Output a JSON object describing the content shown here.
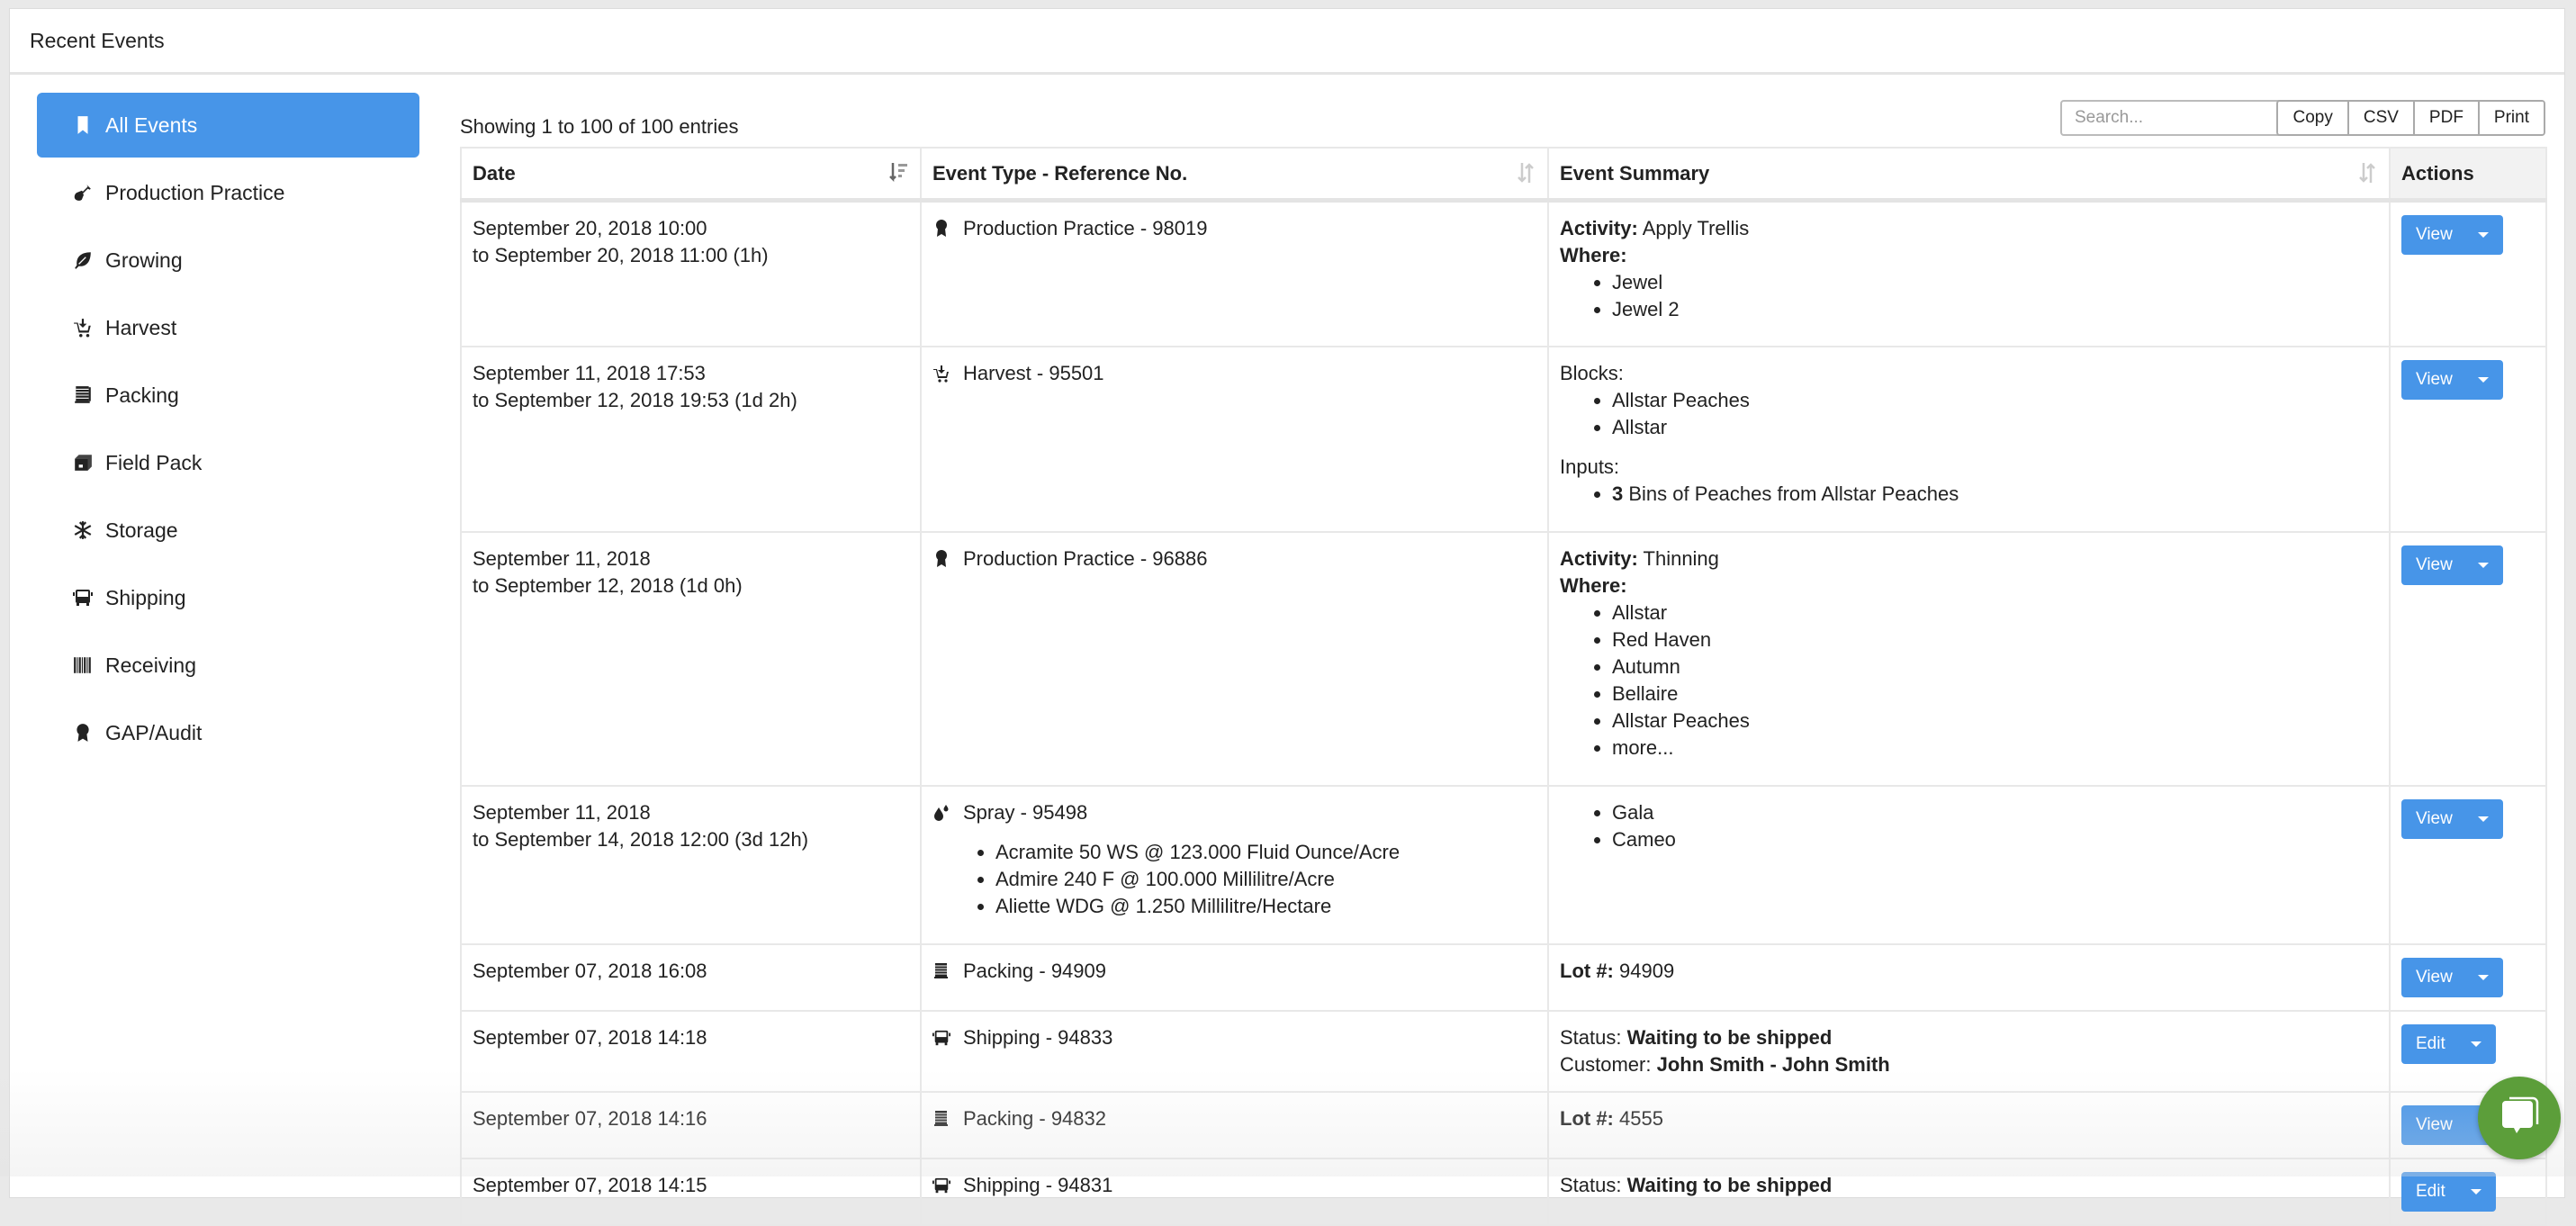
{
  "panel": {
    "title": "Recent Events"
  },
  "sidebar": {
    "items": [
      {
        "label": "All Events",
        "icon": "bookmark-icon",
        "active": true
      },
      {
        "label": "Production Practice",
        "icon": "shovel-icon"
      },
      {
        "label": "Growing",
        "icon": "leaf-icon"
      },
      {
        "label": "Harvest",
        "icon": "cart-download-icon"
      },
      {
        "label": "Packing",
        "icon": "pallet-boxes-icon"
      },
      {
        "label": "Field Pack",
        "icon": "box-icon"
      },
      {
        "label": "Storage",
        "icon": "snowflake-icon"
      },
      {
        "label": "Shipping",
        "icon": "truck-icon"
      },
      {
        "label": "Receiving",
        "icon": "barcode-icon"
      },
      {
        "label": "GAP/Audit",
        "icon": "award-icon"
      }
    ]
  },
  "toolbar": {
    "showing": "Showing 1 to 100 of 100 entries",
    "search_placeholder": "Search...",
    "search_value": "",
    "buttons": {
      "copy": "Copy",
      "csv": "CSV",
      "pdf": "PDF",
      "print": "Print"
    }
  },
  "table": {
    "headers": {
      "date": "Date",
      "event_type": "Event Type - Reference No.",
      "summary": "Event Summary",
      "actions": "Actions"
    },
    "rows": [
      {
        "date1": "September 20, 2018 10:00",
        "date2": "to September 20, 2018 11:00 (1h)",
        "type": "Production Practice - 98019",
        "icon": "award-icon",
        "activity_label": "Activity:",
        "activity": "Apply Trellis",
        "where_label": "Where:",
        "where": [
          "Jewel",
          "Jewel 2"
        ],
        "action": "View"
      },
      {
        "date1": "September 11, 2018 17:53",
        "date2": "to September 12, 2018 19:53 (1d 2h)",
        "type": "Harvest - 95501",
        "icon": "cart-download-icon",
        "blocks_label": "Blocks:",
        "blocks": [
          "Allstar Peaches",
          "Allstar"
        ],
        "inputs_label": "Inputs:",
        "inputs_qty": "3",
        "inputs_text": "Bins of Peaches from Allstar Peaches",
        "action": "View"
      },
      {
        "date1": "September 11, 2018",
        "date2": "to September 12, 2018 (1d 0h)",
        "type": "Production Practice - 96886",
        "icon": "award-icon",
        "activity_label": "Activity:",
        "activity": "Thinning",
        "where_label": "Where:",
        "where": [
          "Allstar",
          "Red Haven",
          "Autumn",
          "Bellaire",
          "Allstar Peaches",
          "more..."
        ],
        "action": "View"
      },
      {
        "date1": "September 11, 2018",
        "date2": "to September 14, 2018 12:00 (3d 12h)",
        "type": "Spray - 95498",
        "icon": "droplets-icon",
        "products": [
          "Acramite 50 WS @ 123.000 Fluid Ounce/Acre",
          "Admire 240 F @ 100.000 Millilitre/Acre",
          "Aliette WDG @ 1.250 Millilitre/Hectare"
        ],
        "varieties": [
          "Gala",
          "Cameo"
        ],
        "action": "View"
      },
      {
        "date1": "September 07, 2018 16:08",
        "type": "Packing - 94909",
        "icon": "pallet-boxes-icon",
        "lot_label": "Lot #:",
        "lot": "94909",
        "action": "View"
      },
      {
        "date1": "September 07, 2018 14:18",
        "type": "Shipping - 94833",
        "icon": "truck-icon",
        "status_label": "Status:",
        "status": "Waiting to be shipped",
        "customer_label": "Customer:",
        "customer": "John Smith - John Smith",
        "action": "Edit"
      },
      {
        "date1": "September 07, 2018 14:16",
        "type": "Packing - 94832",
        "icon": "pallet-boxes-icon",
        "lot_label": "Lot #:",
        "lot": "4555",
        "action": "View"
      },
      {
        "date1": "September 07, 2018 14:15",
        "type": "Shipping - 94831",
        "icon": "truck-icon",
        "status_label": "Status:",
        "status": "Waiting to be shipped",
        "action": "Edit"
      }
    ]
  },
  "colors": {
    "accent": "#4795e8",
    "chat": "#5c9e3a"
  }
}
